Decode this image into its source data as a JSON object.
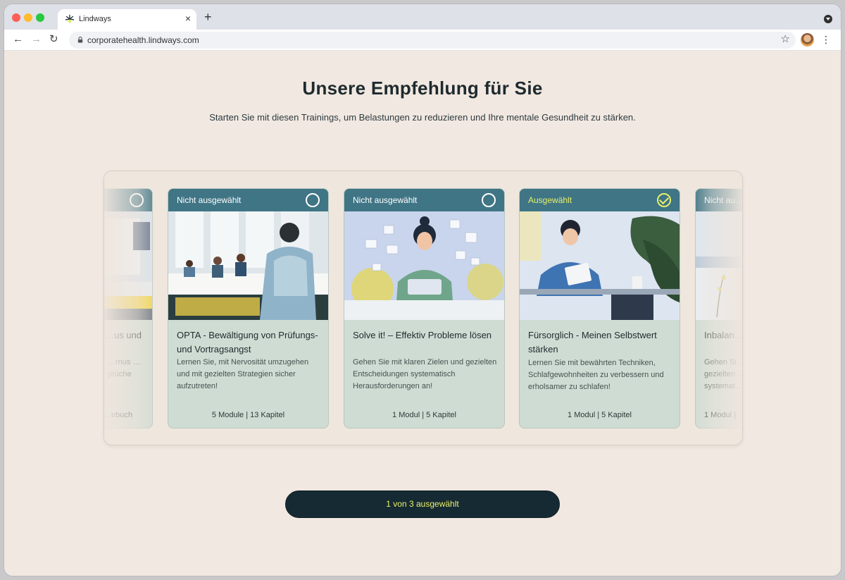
{
  "browser": {
    "tab_title": "Lindways",
    "url": "corporatehealth.lindways.com",
    "new_tab_symbol": "+",
    "close_symbol": "×"
  },
  "page": {
    "heading": "Unsere Empfehlung für Sie",
    "subheading": "Starten Sie mit diesen Trainings, um Belastungen zu reduzieren und Ihre mentale Gesundheit zu stärken."
  },
  "cards": [
    {
      "status": "",
      "selected": false,
      "title": "…us und",
      "description": "…rnus …prüche",
      "meta": "…ebuch"
    },
    {
      "status": "Nicht ausgewählt",
      "selected": false,
      "title": "OPTA - Bewältigung von Prüfungs- und Vortragsangst",
      "description": "Lernen Sie, mit Nervosität umzugehen und mit gezielten Strategien sicher aufzutreten!",
      "meta": "5 Module | 13 Kapitel"
    },
    {
      "status": "Nicht ausgewählt",
      "selected": false,
      "title": "Solve it! – Effektiv Probleme lösen",
      "description": "Gehen Sie mit klaren Zielen und gezielten Entscheidungen systematisch Herausforderungen an!",
      "meta": "1 Modul | 5 Kapitel"
    },
    {
      "status": "Ausgewählt",
      "selected": true,
      "title": "Fürsorglich - Meinen Selbstwert stärken",
      "description": "Lernen Sie mit bewährten Techniken, Schlafgewohnheiten zu verbessern und erholsamer zu schlafen!",
      "meta": "1 Modul | 5 Kapitel"
    },
    {
      "status": "Nicht au…",
      "selected": false,
      "title": "Inbalan…",
      "description": "Gehen Si… gezielten… systemat…",
      "meta": "1 Modul |"
    }
  ],
  "cta": {
    "label": "1 von 3 ausgewählt"
  },
  "colors": {
    "page_bg": "#f1e8e1",
    "card_bg": "#cfdcd3",
    "card_header": "#3f7585",
    "accent_yellow": "#e8f06a",
    "cta_bg": "#162a33"
  },
  "icons": [
    "lindways-logo-icon",
    "close-icon",
    "plus-icon",
    "back-arrow-icon",
    "forward-arrow-icon",
    "reload-icon",
    "lock-icon",
    "star-icon",
    "avatar",
    "kebab-menu-icon",
    "check-circle-icon",
    "checkmark-icon"
  ]
}
